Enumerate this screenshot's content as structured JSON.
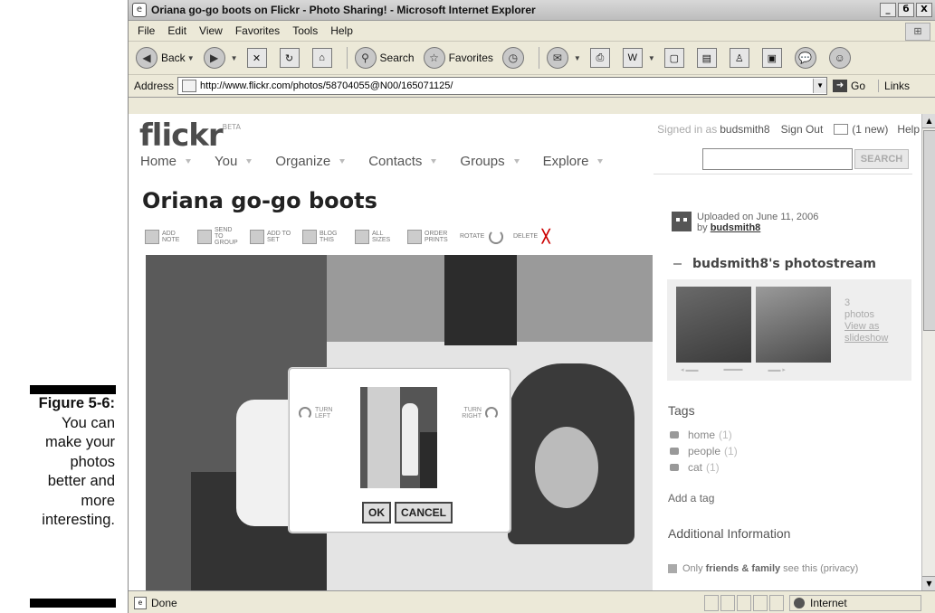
{
  "caption": {
    "figure": "Figure 5-6:",
    "lines": [
      "You can",
      "make your",
      "photos",
      "better and",
      "more",
      "interesting."
    ]
  },
  "browser": {
    "title": "Oriana go-go boots on Flickr - Photo Sharing! - Microsoft Internet Explorer",
    "window_buttons": [
      "_",
      "б",
      "X"
    ],
    "menu": [
      "File",
      "Edit",
      "View",
      "Favorites",
      "Tools",
      "Help"
    ],
    "toolbar": {
      "back": "Back",
      "search": "Search",
      "favorites": "Favorites"
    },
    "address_label": "Address",
    "url": "http://www.flickr.com/photos/58704055@N00/165071125/",
    "go_label": "Go",
    "links_label": "Links",
    "status_text": "Done",
    "zone": "Internet"
  },
  "flickr": {
    "logo": "flickr",
    "logo_badge": "BETA",
    "nav": [
      "Home",
      "You",
      "Organize",
      "Contacts",
      "Groups",
      "Explore"
    ],
    "signed_in_prefix": "Signed in as",
    "username": "budsmith8",
    "sign_out": "Sign Out",
    "messages": "(1 new)",
    "help": "Help",
    "search_value": "",
    "search_button": "SEARCH",
    "photo_title": "Oriana go-go boots",
    "actions": [
      {
        "label": "ADD NOTE"
      },
      {
        "label": "SEND TO GROUP"
      },
      {
        "label": "ADD TO SET"
      },
      {
        "label": "BLOG THIS"
      },
      {
        "label": "ALL SIZES"
      },
      {
        "label": "ORDER PRINTS"
      },
      {
        "label": "ROTATE"
      },
      {
        "label": "DELETE"
      }
    ],
    "rotate_dialog": {
      "turn_left": "TURN LEFT",
      "turn_right": "TURN RIGHT",
      "ok": "OK",
      "cancel": "CANCEL"
    },
    "uploaded_on": "Uploaded on June 11, 2006",
    "uploaded_by_prefix": "by",
    "uploaded_by": "budsmith8",
    "photostream_title": "budsmith8's photostream",
    "photostream_count": "3",
    "photostream_count_label": "photos",
    "view_as_slideshow": "View as slideshow",
    "tags_title": "Tags",
    "tags": [
      {
        "name": "home",
        "count": "(1)"
      },
      {
        "name": "people",
        "count": "(1)"
      },
      {
        "name": "cat",
        "count": "(1)"
      }
    ],
    "add_tag": "Add a tag",
    "additional_info": "Additional Information",
    "privacy_prefix": "Only",
    "privacy_bold": "friends & family",
    "privacy_suffix": "see this (privacy)"
  }
}
